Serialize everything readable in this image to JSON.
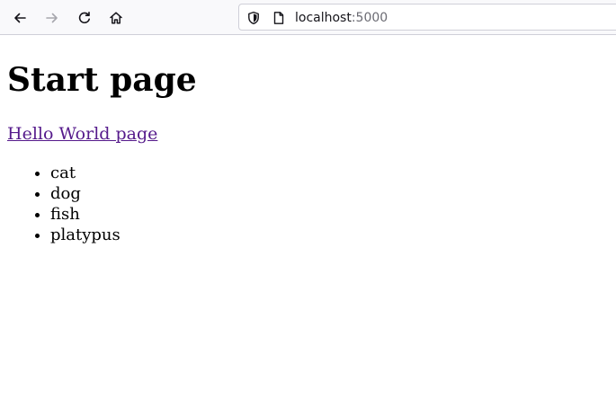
{
  "browser": {
    "url_host": "localhost",
    "url_port": ":5000",
    "icons": {
      "back": "back-arrow-icon",
      "forward": "forward-arrow-icon",
      "reload": "reload-icon",
      "home": "home-icon",
      "shield": "shield-icon",
      "page": "page-icon"
    }
  },
  "page": {
    "title": "Start page",
    "link_text": "Hello World page",
    "list_items": [
      "cat",
      "dog",
      "fish",
      "platypus"
    ]
  },
  "colors": {
    "link_visited": "#551a8b",
    "toolbar_bg": "#f9f9fb"
  }
}
